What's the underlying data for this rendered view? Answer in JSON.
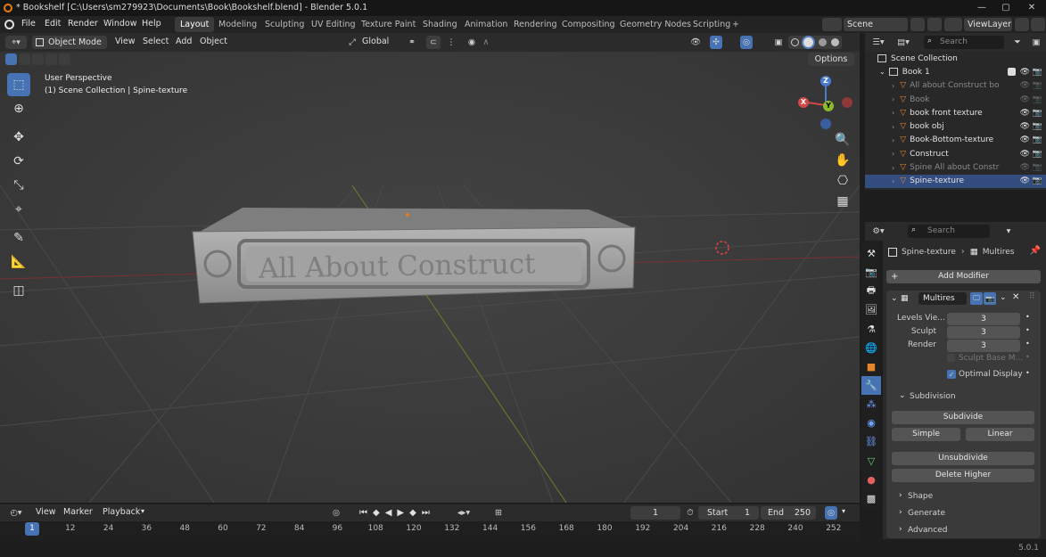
{
  "window": {
    "title": "* Bookshelf [C:\\Users\\sm279923\\Documents\\Book\\Bookshelf.blend] - Blender 5.0.1",
    "min": "—",
    "max": "▢",
    "close": "✕"
  },
  "menubar": {
    "items": [
      "File",
      "Edit",
      "Render",
      "Window",
      "Help"
    ],
    "workspaces": [
      "Layout",
      "Modeling",
      "Sculpting",
      "UV Editing",
      "Texture Paint",
      "Shading",
      "Animation",
      "Rendering",
      "Compositing",
      "Geometry Nodes",
      "Scripting"
    ],
    "add_ws": "+",
    "scene_label": "Scene",
    "viewlayer_label": "ViewLayer"
  },
  "viewport_header": {
    "mode": "Object Mode",
    "menus": [
      "View",
      "Select",
      "Add",
      "Object"
    ],
    "orientation": "Global",
    "options": "Options"
  },
  "viewport": {
    "perspective": "User Perspective",
    "collection": "(1) Scene Collection | Spine-texture",
    "book_text": "All About Construct",
    "gizmo": {
      "z": "Z",
      "y": "Y",
      "x": "X"
    }
  },
  "outliner": {
    "search_placeholder": "Search",
    "root": "Scene Collection",
    "collection": "Book 1",
    "items": [
      {
        "label": "All about Construct bo",
        "dim": true
      },
      {
        "label": "Book",
        "dim": true
      },
      {
        "label": "book front texture",
        "dim": false
      },
      {
        "label": "book obj",
        "dim": false
      },
      {
        "label": "Book-Bottom-texture",
        "dim": false
      },
      {
        "label": "Construct",
        "dim": false
      },
      {
        "label": "Spine All about Constr",
        "dim": true
      },
      {
        "label": "Spine-texture",
        "dim": false,
        "selected": true
      }
    ]
  },
  "properties": {
    "search_placeholder": "Search",
    "breadcrumb_object": "Spine-texture",
    "breadcrumb_modifier": "Multires",
    "add_modifier": "Add Modifier",
    "modifier_name": "Multires",
    "fields": [
      {
        "label": "Levels Vie...",
        "value": "3"
      },
      {
        "label": "Sculpt",
        "value": "3"
      },
      {
        "label": "Render",
        "value": "3"
      }
    ],
    "sculpt_base": "Sculpt Base M...",
    "optimal_display": "Optimal Display",
    "subdivision_panel": "Subdivision",
    "subdivide": "Subdivide",
    "simple": "Simple",
    "linear": "Linear",
    "unsubdivide": "Unsubdivide",
    "delete_higher": "Delete Higher",
    "shape": "Shape",
    "generate": "Generate",
    "advanced": "Advanced"
  },
  "timeline": {
    "menus": [
      "View",
      "Marker",
      "Playback"
    ],
    "current_frame": "1",
    "start_label": "Start",
    "start": "1",
    "end_label": "End",
    "end": "250",
    "frames": [
      "1",
      "12",
      "24",
      "36",
      "48",
      "60",
      "72",
      "84",
      "96",
      "108",
      "120",
      "132",
      "144",
      "156",
      "168",
      "180",
      "192",
      "204",
      "216",
      "228",
      "240",
      "252"
    ]
  },
  "statusbar": {
    "version": "5.0.1"
  }
}
